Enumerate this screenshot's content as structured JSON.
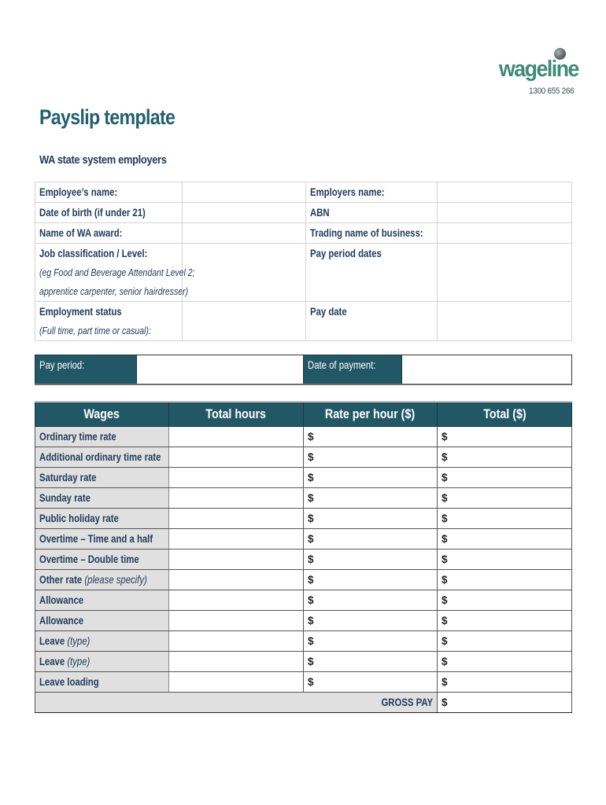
{
  "logo": {
    "brand": "wageline",
    "phone": "1300 655 266"
  },
  "header": {
    "title": "Payslip template",
    "subtitle": "WA state system employers"
  },
  "details": {
    "left": [
      {
        "label": "Employee’s name:",
        "hint": "",
        "value": ""
      },
      {
        "label": "Date of birth (if under 21)",
        "hint": "",
        "value": ""
      },
      {
        "label": "Name of WA award:",
        "hint": "",
        "value": ""
      },
      {
        "label": "Job classification / Level:",
        "hint": "(eg Food and Beverage Attendant Level 2;",
        "hint2": "apprentice carpenter, senior hairdresser)",
        "value": ""
      },
      {
        "label": "Employment status",
        "hint": "(Full time, part time or casual):",
        "value": ""
      }
    ],
    "right": [
      {
        "label": "Employers name:",
        "value": ""
      },
      {
        "label": "ABN",
        "value": ""
      },
      {
        "label": "Trading name of business:",
        "value": ""
      },
      {
        "label": "Pay period dates",
        "value": ""
      },
      {
        "label": "Pay date",
        "value": ""
      }
    ]
  },
  "period": {
    "pay_period_label": "Pay period:",
    "pay_period_value": "",
    "date_of_payment_label": "Date of payment:",
    "date_of_payment_value": ""
  },
  "wages": {
    "headers": [
      "Wages",
      "Total hours",
      "Rate per hour ($)",
      "Total ($)"
    ],
    "currency_symbol": "$",
    "rows": [
      {
        "name": "Ordinary time rate",
        "note": ""
      },
      {
        "name": "Additional ordinary time rate",
        "note": ""
      },
      {
        "name": "Saturday rate",
        "note": ""
      },
      {
        "name": "Sunday rate",
        "note": ""
      },
      {
        "name": "Public holiday rate",
        "note": ""
      },
      {
        "name": "Overtime – Time and a half",
        "note": ""
      },
      {
        "name": "Overtime – Double time",
        "note": ""
      },
      {
        "name": "Other rate",
        "note": "(please specify)"
      },
      {
        "name": "Allowance",
        "note": ""
      },
      {
        "name": "Allowance",
        "note": ""
      },
      {
        "name": "Leave",
        "note": "(type)"
      },
      {
        "name": "Leave",
        "note": "(type)"
      },
      {
        "name": "Leave loading",
        "note": ""
      }
    ],
    "gross_pay_label": "GROSS PAY",
    "gross_pay_value": "$"
  }
}
